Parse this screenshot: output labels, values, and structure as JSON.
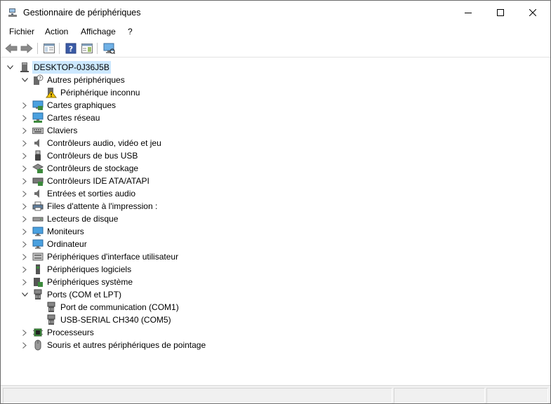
{
  "window": {
    "title": "Gestionnaire de périphériques"
  },
  "menu": [
    "Fichier",
    "Action",
    "Affichage",
    "?"
  ],
  "toolbar": [
    "back-icon",
    "forward-icon",
    "properties-icon",
    "help-icon",
    "show-hide-icon",
    "monitor-scan-icon"
  ],
  "tree": {
    "root": "DESKTOP-0J36J5B",
    "categories": [
      {
        "label": "Autres périphériques",
        "expanded": true,
        "children": [
          "Périphérique inconnu"
        ]
      },
      {
        "label": "Cartes graphiques"
      },
      {
        "label": "Cartes réseau"
      },
      {
        "label": "Claviers"
      },
      {
        "label": "Contrôleurs audio, vidéo et jeu"
      },
      {
        "label": "Contrôleurs de bus USB"
      },
      {
        "label": "Contrôleurs de stockage"
      },
      {
        "label": "Contrôleurs IDE ATA/ATAPI"
      },
      {
        "label": "Entrées et sorties audio"
      },
      {
        "label": "Files d'attente à l'impression :"
      },
      {
        "label": "Lecteurs de disque"
      },
      {
        "label": "Moniteurs"
      },
      {
        "label": "Ordinateur"
      },
      {
        "label": "Périphériques d'interface utilisateur"
      },
      {
        "label": "Périphériques logiciels"
      },
      {
        "label": "Périphériques système"
      },
      {
        "label": "Ports (COM et LPT)",
        "expanded": true,
        "children": [
          "Port de communication (COM1)",
          "USB-SERIAL CH340 (COM5)"
        ]
      },
      {
        "label": "Processeurs"
      },
      {
        "label": "Souris et autres périphériques de pointage"
      }
    ]
  }
}
